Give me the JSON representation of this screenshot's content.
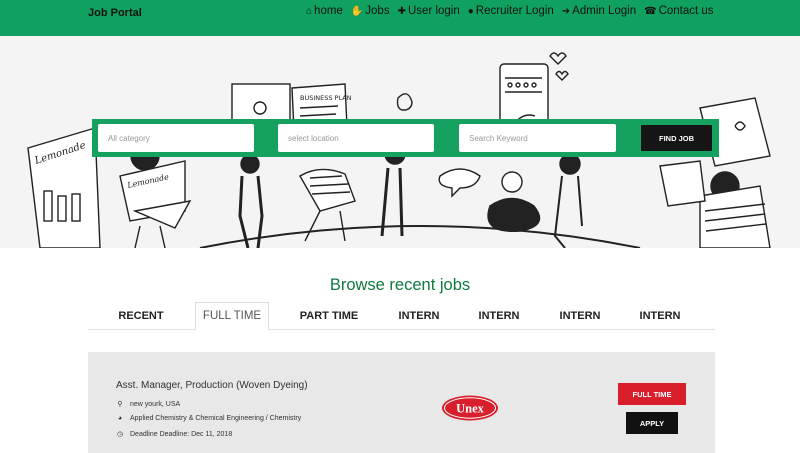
{
  "nav": {
    "brand": "Job Portal",
    "items": [
      {
        "label": "home",
        "icon": "home-icon",
        "glyph": "⌂"
      },
      {
        "label": "Jobs",
        "icon": "handshake-icon",
        "glyph": "✋"
      },
      {
        "label": "User login",
        "icon": "user-plus-icon",
        "glyph": "✚"
      },
      {
        "label": "Recruiter Login",
        "icon": "user-icon",
        "glyph": "●"
      },
      {
        "label": "Admin Login",
        "icon": "sign-in-icon",
        "glyph": "➔"
      },
      {
        "label": "Contact us",
        "icon": "phone-icon",
        "glyph": "☎"
      }
    ]
  },
  "search": {
    "category_placeholder": "All category",
    "location_placeholder": "select location",
    "keyword_placeholder": "Search Keyword",
    "button": "FIND JOB"
  },
  "browse": {
    "title": "Browse recent jobs",
    "tabs": [
      "RECENT",
      "FULL TIME",
      "PART TIME",
      "INTERN",
      "INTERN",
      "INTERN",
      "INTERN"
    ],
    "active_tab": "FULL TIME"
  },
  "job": {
    "title": "Asst. Manager, Production (Woven Dyeing)",
    "location": "new yourk, USA",
    "field": "Applied Chemistry & Chemical Engineering / Chemistry",
    "deadline": "Deadline Deadline: Dec 11, 2018",
    "company_logo": "Unex",
    "type_button": "FULL TIME",
    "apply_button": "APPLY"
  },
  "hero": {
    "sketch_texts": [
      "Lemonade",
      "Lemonade",
      "BUSINESS PLAN"
    ]
  },
  "colors": {
    "primary": "#10a060",
    "title": "#0f7a40",
    "danger": "#d71e2a"
  }
}
